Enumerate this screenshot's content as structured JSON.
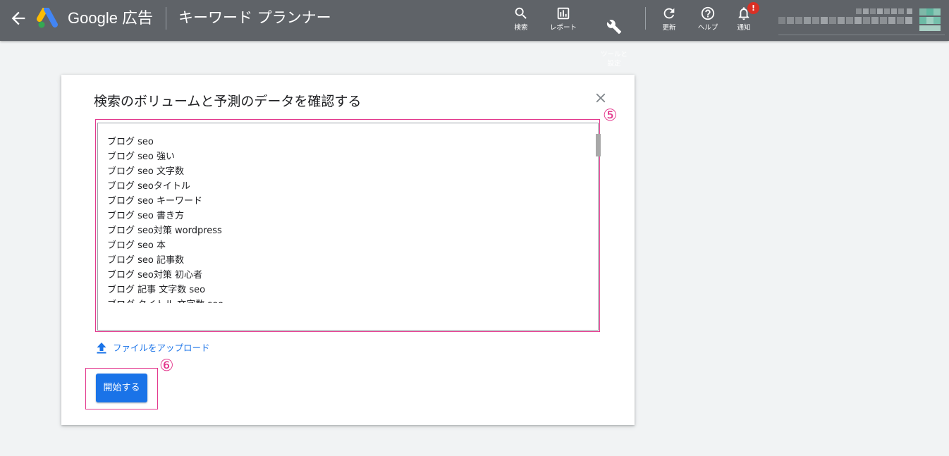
{
  "header": {
    "brand": "Google 広告",
    "page_name": "キーワード プランナー",
    "tools": [
      {
        "label": "検索",
        "icon": "search-icon"
      },
      {
        "label": "レポート",
        "icon": "report-icon"
      },
      {
        "label": "ツールと\n設定",
        "icon": "wrench-icon"
      },
      {
        "label": "更新",
        "icon": "refresh-icon"
      },
      {
        "label": "ヘルプ",
        "icon": "help-icon"
      },
      {
        "label": "通知",
        "icon": "bell-icon"
      }
    ],
    "notification_badge": "!",
    "colors": {
      "bar": "#5f6368",
      "badge": "#d93025"
    }
  },
  "dialog": {
    "title": "検索のボリュームと予測のデータを確認する",
    "keywords": [
      "ブログ seo",
      "ブログ seo 強い",
      "ブログ seo 文字数",
      "ブログ seoタイトル",
      "ブログ seo キーワード",
      "ブログ seo 書き方",
      "ブログ seo対策 wordpress",
      "ブログ seo 本",
      "ブログ seo 記事数",
      "ブログ seo対策 初心者",
      "ブログ 記事 文字数 seo",
      "ブログ タイトル 文字数 seo"
    ],
    "upload_label": "ファイルをアップロード",
    "start_button": "開始する",
    "colors": {
      "primary": "#1a73e8"
    }
  },
  "annotations": {
    "textarea_marker": "⑤",
    "button_marker": "⑥",
    "color": "#e3388d"
  }
}
